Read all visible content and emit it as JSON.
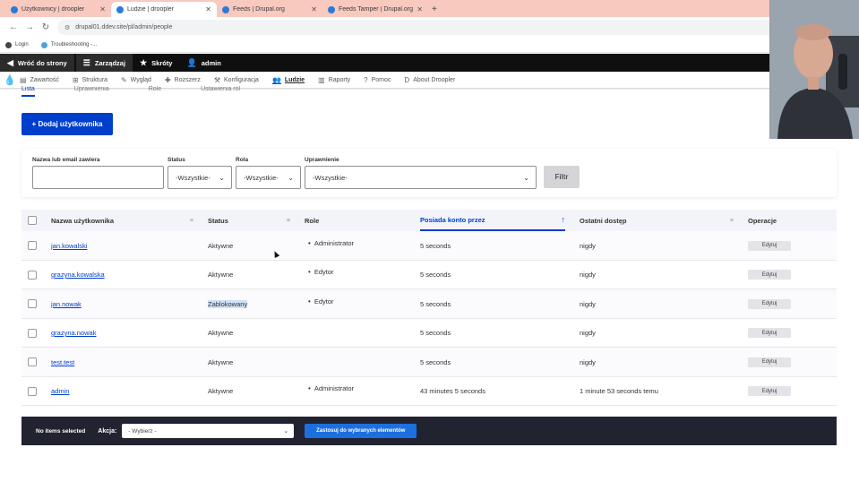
{
  "browser": {
    "tabs": [
      {
        "title": "Użytkownicy | droopler",
        "active": false
      },
      {
        "title": "Ludzie | droopler",
        "active": true
      },
      {
        "title": "Feeds | Drupal.org",
        "active": false
      },
      {
        "title": "Feeds Tamper | Drupal.org",
        "active": false
      }
    ],
    "new_tab": "+",
    "url": "drupal01.ddev.site/pl/admin/people",
    "bookmarks": [
      "Login",
      "Troubleshooting -..."
    ]
  },
  "admin_bar": {
    "back": "Wróć do strony",
    "manage": "Zarządzaj",
    "shortcuts": "Skróty",
    "user": "admin"
  },
  "toolbar": {
    "items": [
      "Zawartość",
      "Struktura",
      "Wygląd",
      "Rozszerz",
      "Konfiguracja",
      "Ludzie",
      "Raporty",
      "Pomoc",
      "About Droopler"
    ]
  },
  "subtabs": [
    "Lista",
    "Uprawnienia",
    "Role",
    "Ustawienia ról"
  ],
  "add_user_label": "+ Dodaj użytkownika",
  "filter": {
    "name_label": "Nazwa lub email zawiera",
    "name_value": "",
    "status_label": "Status",
    "status_value": "-Wszystkie-",
    "role_label": "Rola",
    "role_value": "-Wszystkie-",
    "permission_label": "Uprawnienie",
    "permission_value": "-Wszystkie-",
    "submit": "Filtr"
  },
  "table": {
    "headers": {
      "username": "Nazwa użytkownika",
      "status": "Status",
      "roles": "Role",
      "member_for": "Posiada konto przez",
      "last_access": "Ostatni dostęp",
      "operations": "Operacje"
    },
    "rows": [
      {
        "username": "jan.kowalski",
        "status": "Aktywne",
        "role": "Administrator",
        "member_for": "5 seconds",
        "last_access": "nigdy",
        "op": "Edytuj"
      },
      {
        "username": "grazyna.kowalska",
        "status": "Aktywne",
        "role": "Edytor",
        "member_for": "5 seconds",
        "last_access": "nigdy",
        "op": "Edytuj"
      },
      {
        "username": "jan.nowak",
        "status": "Zablokowany",
        "role": "Edytor",
        "member_for": "5 seconds",
        "last_access": "nigdy",
        "op": "Edytuj"
      },
      {
        "username": "grazyna.nowak",
        "status": "Aktywne",
        "role": "",
        "member_for": "5 seconds",
        "last_access": "nigdy",
        "op": "Edytuj"
      },
      {
        "username": "test.test",
        "status": "Aktywne",
        "role": "",
        "member_for": "5 seconds",
        "last_access": "nigdy",
        "op": "Edytuj"
      },
      {
        "username": "admin",
        "status": "Aktywne",
        "role": "Administrator",
        "member_for": "43 minutes 5 seconds",
        "last_access": "1 minute 53 seconds temu",
        "op": "Edytuj"
      }
    ]
  },
  "bulk": {
    "none_selected": "No items selected",
    "action_label": "Akcja:",
    "action_value": "- Wybierz -",
    "apply": "Zastosuj do wybranych elementów"
  }
}
